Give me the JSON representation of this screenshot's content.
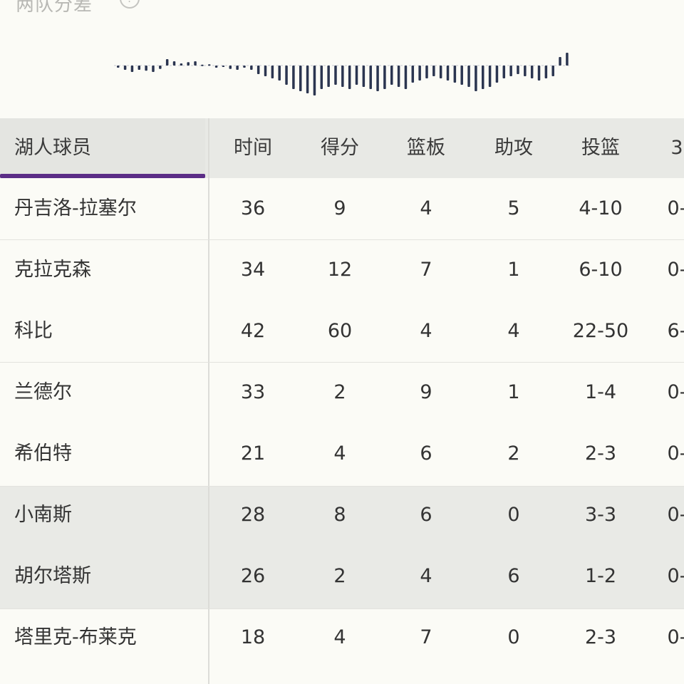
{
  "panel": {
    "title": "两队分差",
    "help_icon": "help-circle-icon"
  },
  "momentum": {
    "bars": [
      -0.05,
      -0.1,
      -0.15,
      -0.1,
      -0.12,
      -0.15,
      -0.08,
      0.15,
      0.1,
      0.05,
      0.08,
      0.1,
      0.02,
      0.03,
      -0.05,
      0.0,
      -0.08,
      -0.1,
      -0.05,
      -0.1,
      -0.2,
      -0.25,
      -0.3,
      -0.35,
      -0.45,
      -0.55,
      -0.6,
      -0.65,
      -0.7,
      -0.55,
      -0.5,
      -0.45,
      -0.5,
      -0.55,
      -0.45,
      -0.5,
      -0.55,
      -0.6,
      -0.55,
      -0.45,
      -0.5,
      -0.55,
      -0.4,
      -0.35,
      -0.3,
      -0.25,
      -0.3,
      -0.35,
      -0.4,
      -0.45,
      -0.5,
      -0.6,
      -0.55,
      -0.5,
      -0.4,
      -0.3,
      -0.25,
      -0.2,
      -0.25,
      -0.3,
      -0.35,
      -0.3,
      -0.25,
      0.2,
      0.3
    ],
    "color": "#2b3550"
  },
  "table": {
    "team_header": "湖人球员",
    "columns": [
      "时间",
      "得分",
      "篮板",
      "助攻",
      "投篮",
      "3"
    ],
    "rows": [
      {
        "name": "丹吉洛-拉塞尔",
        "cells": [
          "36",
          "9",
          "4",
          "5",
          "4-10",
          "0-"
        ]
      },
      {
        "name": "克拉克森",
        "cells": [
          "34",
          "12",
          "7",
          "1",
          "6-10",
          "0-"
        ]
      },
      {
        "name": "科比",
        "cells": [
          "42",
          "60",
          "4",
          "4",
          "22-50",
          "6-"
        ]
      },
      {
        "name": "兰德尔",
        "cells": [
          "33",
          "2",
          "9",
          "1",
          "1-4",
          "0-"
        ]
      },
      {
        "name": "希伯特",
        "cells": [
          "21",
          "4",
          "6",
          "2",
          "2-3",
          "0-"
        ]
      },
      {
        "name": "小南斯",
        "cells": [
          "28",
          "8",
          "6",
          "0",
          "3-3",
          "0-"
        ]
      },
      {
        "name": "胡尔塔斯",
        "cells": [
          "26",
          "2",
          "4",
          "6",
          "1-2",
          "0-"
        ]
      },
      {
        "name": "塔里克-布莱克",
        "cells": [
          "18",
          "4",
          "7",
          "0",
          "2-3",
          "0-"
        ]
      }
    ],
    "accent": "#5b2d86"
  }
}
